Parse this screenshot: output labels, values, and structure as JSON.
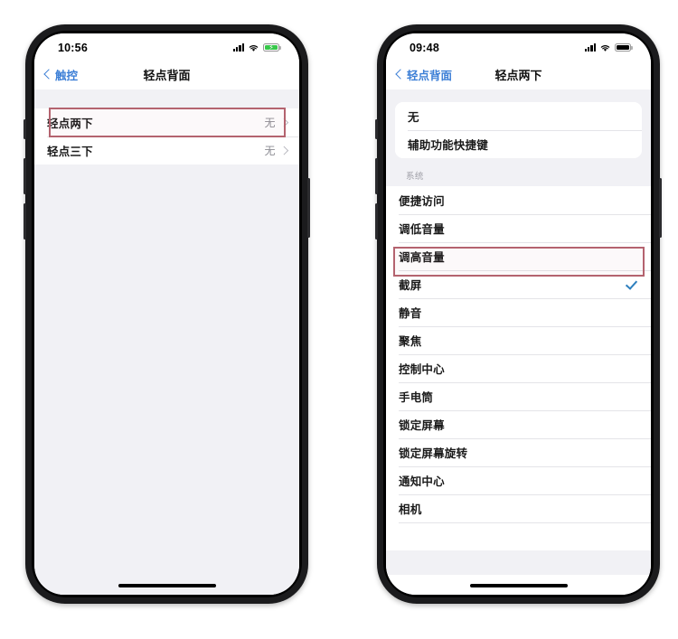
{
  "left_phone": {
    "status_bar": {
      "time": "10:56",
      "signal_icon": "cellular-signal-icon",
      "wifi_icon": "wifi-icon",
      "battery_icon": "battery-charging-icon",
      "battery_color": "#37c74a",
      "charging_glyph": "⚡"
    },
    "nav": {
      "back_label": "触控",
      "back_icon": "chevron-left-icon",
      "title": "轻点背面"
    },
    "rows": [
      {
        "label": "轻点两下",
        "value": "无",
        "accessory": "chevron-right-icon",
        "highlighted": true
      },
      {
        "label": "轻点三下",
        "value": "无",
        "accessory": "chevron-right-icon",
        "highlighted": false
      }
    ],
    "highlight_color": "#b4636f"
  },
  "right_phone": {
    "status_bar": {
      "time": "09:48",
      "signal_icon": "cellular-signal-icon",
      "wifi_icon": "wifi-icon",
      "battery_icon": "battery-full-icon",
      "battery_color": "#000000"
    },
    "nav": {
      "back_label": "轻点背面",
      "back_icon": "chevron-left-icon",
      "title": "轻点两下"
    },
    "group_top": [
      {
        "label": "无",
        "selected": false
      },
      {
        "label": "辅助功能快捷键",
        "selected": false
      }
    ],
    "section_title": "系统",
    "group_system": [
      {
        "label": "便捷访问",
        "selected": false
      },
      {
        "label": "调低音量",
        "selected": false
      },
      {
        "label": "调高音量",
        "selected": false
      },
      {
        "label": "截屏",
        "selected": true,
        "accessory": "checkmark-icon",
        "highlighted": true
      },
      {
        "label": "静音",
        "selected": false
      },
      {
        "label": "聚焦",
        "selected": false
      },
      {
        "label": "控制中心",
        "selected": false
      },
      {
        "label": "手电筒",
        "selected": false
      },
      {
        "label": "锁定屏幕",
        "selected": false
      },
      {
        "label": "锁定屏幕旋转",
        "selected": false
      },
      {
        "label": "通知中心",
        "selected": false
      },
      {
        "label": "相机",
        "selected": false
      }
    ],
    "highlight_color": "#b4636f",
    "checkmark_color": "#2d7fbe"
  }
}
